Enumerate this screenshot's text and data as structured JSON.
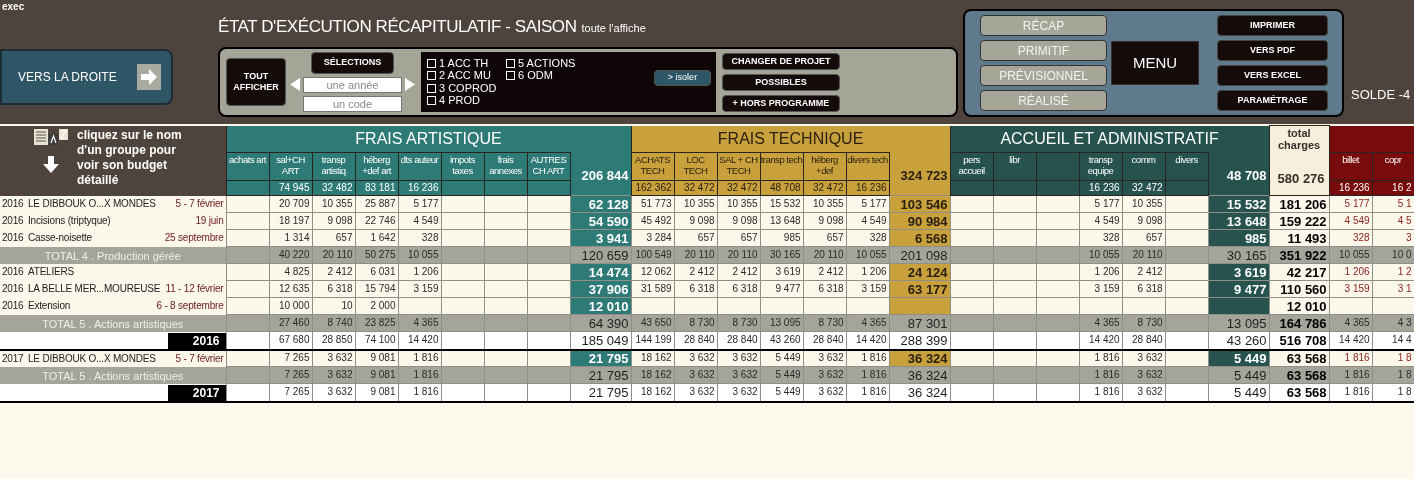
{
  "app_label": "exec",
  "title": "ÉTAT D'EXÉCUTION RÉCAPITULATIF - SAISON",
  "title_suffix": "toute l'affiche",
  "nav_button": "VERS LA DROITE",
  "show_all_button": "TOUT AFFICHER",
  "selections_label": "SÉLECTIONS",
  "year_field": {
    "placeholder": "une année"
  },
  "code_field": {
    "placeholder": "un code"
  },
  "filters": [
    {
      "label": "1 ACC TH",
      "checked": false
    },
    {
      "label": "2 ACC MU",
      "checked": false
    },
    {
      "label": "3 COPROD",
      "checked": false
    },
    {
      "label": "4 PROD",
      "checked": false
    },
    {
      "label": "5 ACTIONS",
      "checked": false
    },
    {
      "label": "6 ODM",
      "checked": false
    }
  ],
  "isolate_button": "> isoler",
  "project_buttons": [
    "CHANGER DE PROJET",
    "POSSIBLES",
    "+ HORS PROGRAMME"
  ],
  "views": [
    "RÉCAP",
    "PRIMITIF",
    "PRÉVISIONNEL",
    "RÉALISÉ"
  ],
  "menu_button": "MENU",
  "export_buttons": [
    "IMPRIMER",
    "VERS PDF",
    "VERS EXCEL",
    "PARAMÉTRAGE"
  ],
  "balance": "SOLDE -4",
  "hint": "cliquez sur le nom d'un groupe pour voir son budget détaillé",
  "table": {
    "groups": [
      {
        "kind": "art",
        "title": "FRAIS ARTISTIQUE",
        "columns": [
          {
            "label": "achats art"
          },
          {
            "label": "sal+CH ART",
            "total": "74 945"
          },
          {
            "label": "transp artistiq",
            "total": "32 482"
          },
          {
            "label": "héberg +def art",
            "total": "83 181"
          },
          {
            "label": "dts auteur",
            "total": "16 236"
          },
          {
            "label": "impots taxes"
          },
          {
            "label": "frais annexes"
          },
          {
            "label": "AUTRES CH ART"
          }
        ],
        "total": "206 844"
      },
      {
        "kind": "tech",
        "title": "FRAIS TECHNIQUE",
        "columns": [
          {
            "label": "ACHATS TECH",
            "total": "162 362"
          },
          {
            "label": "LOC TECH",
            "total": "32 472"
          },
          {
            "label": "SAL + CH TECH",
            "total": "32 472"
          },
          {
            "label": "transp tech",
            "total": "48 708"
          },
          {
            "label": "héberg +def",
            "total": "32 472"
          },
          {
            "label": "divers tech",
            "total": "16 236"
          }
        ],
        "total": "324 723"
      },
      {
        "kind": "admin",
        "title": "ACCUEIL ET ADMINISTRATIF",
        "columns": [
          {
            "label": "pers accueil"
          },
          {
            "label": "libr"
          },
          {},
          {
            "label": "transp equipe",
            "total": "16 236"
          },
          {
            "label": "comm",
            "total": "32 472"
          },
          {
            "label": "divers"
          }
        ],
        "total": "48 708"
      },
      {
        "kind": "charges",
        "title": "total charges",
        "total": "580 276"
      },
      {
        "kind": "revenue",
        "columns": [
          {
            "label": "billet",
            "total": "16 236"
          },
          {
            "label": "copr",
            "total": "16 2"
          }
        ]
      }
    ],
    "rows": [
      {
        "kind": "item",
        "year": "2016",
        "name": "LE DIBBOUK O...X MONDES",
        "date": "5 - 7 février",
        "cells": [
          null,
          "20 709",
          "10 355",
          "25 887",
          "5 177",
          null,
          null,
          null,
          "62 128",
          "51 773",
          "10 355",
          "10 355",
          "15 532",
          "10 355",
          "5 177",
          "103 546",
          null,
          null,
          null,
          "5 177",
          "10 355",
          null,
          "15 532",
          "181 206",
          "5 177",
          "5 1"
        ]
      },
      {
        "kind": "item",
        "year": "2016",
        "name": "Incisions (triptyque)",
        "date": "19 juin",
        "cells": [
          null,
          "18 197",
          "9 098",
          "22 746",
          "4 549",
          null,
          null,
          null,
          "54 590",
          "45 492",
          "9 098",
          "9 098",
          "13 648",
          "9 098",
          "4 549",
          "90 984",
          null,
          null,
          null,
          "4 549",
          "9 098",
          null,
          "13 648",
          "159 222",
          "4 549",
          "4 5"
        ]
      },
      {
        "kind": "item",
        "year": "2016",
        "name": "Casse-noisette",
        "date": "25 septembre",
        "cells": [
          null,
          "1 314",
          "657",
          "1 642",
          "328",
          null,
          null,
          null,
          "3 941",
          "3 284",
          "657",
          "657",
          "985",
          "657",
          "328",
          "6 568",
          null,
          null,
          null,
          "328",
          "657",
          null,
          "985",
          "11 493",
          "328",
          "3"
        ]
      },
      {
        "kind": "subtotal",
        "label": "TOTAL 4 . Production gérée",
        "cells": [
          null,
          "40 220",
          "20 110",
          "50 275",
          "10 055",
          null,
          null,
          null,
          "120 659",
          "100 549",
          "20 110",
          "20 110",
          "30 165",
          "20 110",
          "10 055",
          "201 098",
          null,
          null,
          null,
          "10 055",
          "20 110",
          null,
          "30 165",
          "351 922",
          "10 055",
          "10 0"
        ]
      },
      {
        "kind": "item",
        "year": "2016",
        "name": "ATELIERS",
        "cells": [
          null,
          "4 825",
          "2 412",
          "6 031",
          "1 206",
          null,
          null,
          null,
          "14 474",
          "12 062",
          "2 412",
          "2 412",
          "3 619",
          "2 412",
          "1 206",
          "24 124",
          null,
          null,
          null,
          "1 206",
          "2 412",
          null,
          "3 619",
          "42 217",
          "1 206",
          "1 2"
        ]
      },
      {
        "kind": "item",
        "year": "2016",
        "name": "LA BELLE MER...MOUREUSE",
        "date": "11 - 12 février",
        "cells": [
          null,
          "12 635",
          "6 318",
          "15 794",
          "3 159",
          null,
          null,
          null,
          "37 906",
          "31 589",
          "6 318",
          "6 318",
          "9 477",
          "6 318",
          "3 159",
          "63 177",
          null,
          null,
          null,
          "3 159",
          "6 318",
          null,
          "9 477",
          "110 560",
          "3 159",
          "3 1"
        ]
      },
      {
        "kind": "item",
        "year": "2016",
        "name": "Extension",
        "date": "6 - 8 septembre",
        "cells": [
          null,
          "10 000",
          "10",
          "2 000",
          null,
          null,
          null,
          null,
          "12 010",
          null,
          null,
          null,
          null,
          null,
          null,
          null,
          null,
          null,
          null,
          null,
          null,
          null,
          null,
          "12 010",
          null,
          null
        ]
      },
      {
        "kind": "subtotal",
        "label": "TOTAL 5 . Actions artistiques",
        "cells": [
          null,
          "27 460",
          "8 740",
          "23 825",
          "4 365",
          null,
          null,
          null,
          "64 390",
          "43 650",
          "8 730",
          "8 730",
          "13 095",
          "8 730",
          "4 365",
          "87 301",
          null,
          null,
          null,
          "4 365",
          "8 730",
          null,
          "13 095",
          "164 786",
          "4 365",
          "4 3"
        ]
      },
      {
        "kind": "year_total",
        "label": "2016",
        "cells": [
          null,
          "67 680",
          "28 850",
          "74 100",
          "14 420",
          null,
          null,
          null,
          "185 049",
          "144 199",
          "28 840",
          "28 840",
          "43 260",
          "28 840",
          "14 420",
          "288 399",
          null,
          null,
          null,
          "14 420",
          "28 840",
          null,
          "43 260",
          "516 708",
          "14 420",
          "14 4"
        ]
      },
      {
        "kind": "item",
        "year": "2017",
        "name": "LE DIBBOUK O...X MONDES",
        "date": "5 - 7 février",
        "cells": [
          null,
          "7 265",
          "3 632",
          "9 081",
          "1 816",
          null,
          null,
          null,
          "21 795",
          "18 162",
          "3 632",
          "3 632",
          "5 449",
          "3 632",
          "1 816",
          "36 324",
          null,
          null,
          null,
          "1 816",
          "3 632",
          null,
          "5 449",
          "63 568",
          "1 816",
          "1 8"
        ]
      },
      {
        "kind": "subtotal",
        "label": "TOTAL 5 . Actions artistiques",
        "cells": [
          null,
          "7 265",
          "3 632",
          "9 081",
          "1 816",
          null,
          null,
          null,
          "21 795",
          "18 162",
          "3 632",
          "3 632",
          "5 449",
          "3 632",
          "1 816",
          "36 324",
          null,
          null,
          null,
          "1 816",
          "3 632",
          null,
          "5 449",
          "63 568",
          "1 816",
          "1 8"
        ]
      },
      {
        "kind": "year_total",
        "label": "2017",
        "cells": [
          null,
          "7 265",
          "3 632",
          "9 081",
          "1 816",
          null,
          null,
          null,
          "21 795",
          "18 162",
          "3 632",
          "3 632",
          "5 449",
          "3 632",
          "1 816",
          "36 324",
          null,
          null,
          null,
          "1 816",
          "3 632",
          null,
          "5 449",
          "63 568",
          "1 816",
          "1 8"
        ]
      }
    ]
  }
}
